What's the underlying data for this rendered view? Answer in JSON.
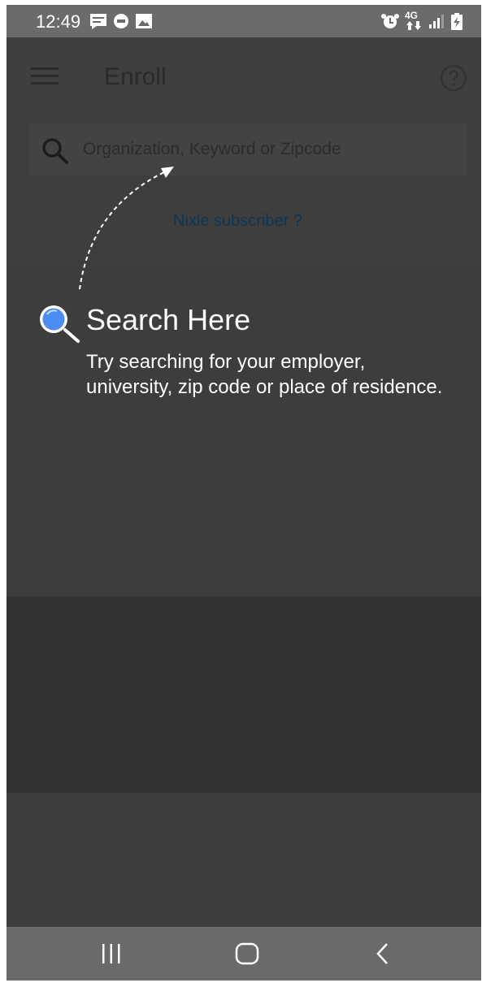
{
  "status_bar": {
    "time": "12:49",
    "icons_left": [
      "message-icon",
      "dex-icon",
      "image-icon"
    ],
    "icons_right": [
      "alarm-icon",
      "lte-icon",
      "signal-icon",
      "battery-icon"
    ],
    "network_label": "4G"
  },
  "app_bar": {
    "title": "Enroll",
    "menu_icon": "hamburger-menu-icon",
    "help_icon": "help-icon"
  },
  "search": {
    "placeholder": "Organization, Keyword or Zipcode",
    "value": ""
  },
  "subscriber_link": "Nixle subscriber ?",
  "hint": {
    "title": "Search Here",
    "body": "Try searching for your employer, university, zip code or place of residence.",
    "icon": "magnifier-icon",
    "icon_color": "#4a8cf0"
  },
  "nav_bar": {
    "buttons": [
      "recent-apps-icon",
      "home-icon",
      "back-icon"
    ]
  },
  "colors": {
    "overlay": "#3e3e3e",
    "status_bar": "#6b6b6b",
    "nav_bar": "#6a6a6a",
    "link": "#0f3553",
    "hint_text": "#ffffff"
  }
}
